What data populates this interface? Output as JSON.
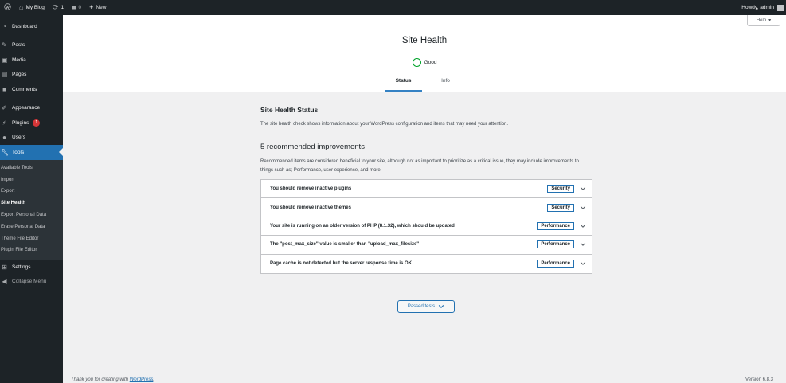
{
  "adminbar": {
    "site_name": "My Blog",
    "updates_count": "1",
    "comments_count": "0",
    "new_label": "New",
    "greeting": "Howdy, admin"
  },
  "sidebar": {
    "items": [
      {
        "label": "Dashboard",
        "icon": "dashboard-icon"
      },
      {
        "label": "Posts",
        "icon": "pin-icon"
      },
      {
        "label": "Media",
        "icon": "media-icon"
      },
      {
        "label": "Pages",
        "icon": "pages-icon"
      },
      {
        "label": "Comments",
        "icon": "comment-icon"
      },
      {
        "label": "Appearance",
        "icon": "brush-icon"
      },
      {
        "label": "Plugins",
        "icon": "plug-icon",
        "badge": "1"
      },
      {
        "label": "Users",
        "icon": "users-icon"
      },
      {
        "label": "Tools",
        "icon": "wrench-icon"
      },
      {
        "label": "Settings",
        "icon": "settings-icon"
      },
      {
        "label": "Collapse Menu",
        "icon": "collapse-icon"
      }
    ],
    "tools_submenu": [
      "Available Tools",
      "Import",
      "Export",
      "Site Health",
      "Export Personal Data",
      "Erase Personal Data",
      "Theme File Editor",
      "Plugin File Editor"
    ]
  },
  "header": {
    "help_label": "Help",
    "title": "Site Health",
    "status_label": "Good",
    "tabs": [
      "Status",
      "Info"
    ]
  },
  "main": {
    "status_heading": "Site Health Status",
    "status_description": "The site health check shows information about your WordPress configuration and items that may need your attention.",
    "recommended_heading": "5 recommended improvements",
    "recommended_description": "Recommended items are considered beneficial to your site, although not as important to prioritize as a critical issue, they may include improvements to things such as; Performance, user experience, and more.",
    "issues": [
      {
        "text": "You should remove inactive plugins",
        "tag": "Security"
      },
      {
        "text": "You should remove inactive themes",
        "tag": "Security"
      },
      {
        "text": "Your site is running on an older version of PHP (8.1.32), which should be updated",
        "tag": "Performance"
      },
      {
        "text": "The \"post_max_size\" value is smaller than \"upload_max_filesize\"",
        "tag": "Performance"
      },
      {
        "text": "Page cache is not detected but the server response time is OK",
        "tag": "Performance"
      }
    ],
    "passed_tests_label": "Passed tests"
  },
  "footer": {
    "thanks_prefix": "Thank you for creating with ",
    "thanks_link": "WordPress",
    "thanks_suffix": ".",
    "version": "Version 6.8.3"
  },
  "colors": {
    "admin_dark": "#1d2327",
    "accent_blue": "#2271b1",
    "good_green": "#00a32a",
    "badge_red": "#d63638"
  }
}
